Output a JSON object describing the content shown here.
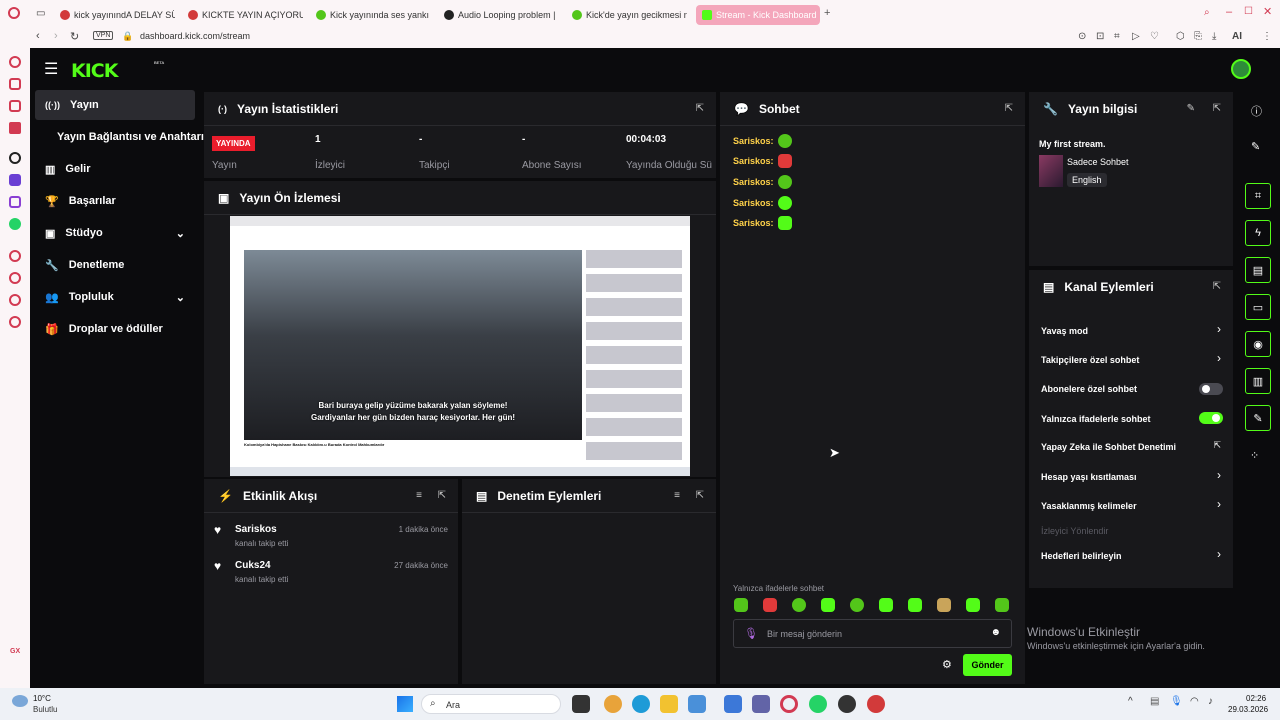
{
  "browser": {
    "tabs": [
      {
        "label": "kick yayınındA DELAY SÜR",
        "color": "#d23a3a"
      },
      {
        "label": "KICKTE YAYIN AÇIYORUM",
        "color": "#d23a3a"
      },
      {
        "label": "Kick yayınında ses yankı y",
        "color": "#53c61a"
      },
      {
        "label": "Audio Looping problem | ",
        "color": "#222222"
      },
      {
        "label": "Kick'de yayın gecikmesi n",
        "color": "#53c61a"
      },
      {
        "label": "Stream - Kick Dashboard",
        "color": "#53fc18"
      }
    ],
    "url": "dashboard.kick.com/stream",
    "vpn": "VPN",
    "ai": "AI"
  },
  "header": {
    "logo": "KICK",
    "beta": "BETA"
  },
  "nav": [
    {
      "label": "Yayın",
      "icon": "broadcast-icon"
    },
    {
      "label": "Yayın Bağlantısı ve Anahtarı",
      "icon": ""
    },
    {
      "label": "Gelir",
      "icon": "chart-icon"
    },
    {
      "label": "Başarılar",
      "icon": "trophy-icon"
    },
    {
      "label": "Stüdyo",
      "icon": "studio-icon"
    },
    {
      "label": "Denetleme",
      "icon": "wrench-icon"
    },
    {
      "label": "Topluluk",
      "icon": "people-icon"
    },
    {
      "label": "Droplar ve ödüller",
      "icon": "gift-icon"
    }
  ],
  "stats": {
    "title": "Yayın İstatistikleri",
    "live": "YAYINDA",
    "items": [
      {
        "value": "",
        "label": "Yayın"
      },
      {
        "value": "1",
        "label": "İzleyici"
      },
      {
        "value": "-",
        "label": "Takipçi"
      },
      {
        "value": "-",
        "label": "Abone Sayısı"
      },
      {
        "value": "00:04:03",
        "label": "Yayında Olduğu Süre"
      }
    ]
  },
  "preview": {
    "title": "Yayın Ön İzlemesi",
    "subtitle_line1": "Bari buraya gelip yüzüme bakarak yalan söyleme!",
    "subtitle_line2": "Gardiyanlar her gün bizden haraç kesiyorlar. Her gün!",
    "video_title": "Kolombiya'da Hapishane Baskısı Kalıldını.u Burada Kontrol Mahkumlardır"
  },
  "activity": {
    "title": "Etkinlik Akışı",
    "items": [
      {
        "user": "Sariskos",
        "action": "kanalı takip etti",
        "time": "1 dakika önce"
      },
      {
        "user": "Cuks24",
        "action": "kanalı takip etti",
        "time": "27 dakika önce"
      }
    ]
  },
  "moderation": {
    "title": "Denetim Eylemleri"
  },
  "chat": {
    "title": "Sohbet",
    "messages": [
      {
        "user": "Sariskos:",
        "emote": "#53c61a"
      },
      {
        "user": "Sariskos:",
        "emote": "#e03a3a"
      },
      {
        "user": "Sariskos:",
        "emote": "#53c61a"
      },
      {
        "user": "Sariskos:",
        "emote": "#53fc18"
      },
      {
        "user": "Sariskos:",
        "emote": "#53fc18"
      }
    ],
    "emotes_only": "Yalnızca ifadelerle sohbet",
    "placeholder": "Bir mesaj gönderin",
    "send": "Gönder"
  },
  "info": {
    "title": "Yayın bilgisi",
    "stream_title": "My first stream.",
    "category": "Sadece Sohbet",
    "language": "English"
  },
  "channel": {
    "title": "Kanal Eylemleri",
    "items": [
      {
        "label": "Yavaş mod",
        "type": "chevron"
      },
      {
        "label": "Takipçilere özel sohbet",
        "type": "chevron"
      },
      {
        "label": "Abonelere özel sohbet",
        "type": "toggle-off"
      },
      {
        "label": "Yalnızca ifadelerle sohbet",
        "type": "toggle-on"
      },
      {
        "label": "Yapay Zeka ile Sohbet Denetimi",
        "type": "external"
      },
      {
        "label": "Hesap yaşı kısıtlaması",
        "type": "chevron"
      },
      {
        "label": "Yasaklanmış kelimeler",
        "type": "chevron"
      },
      {
        "label": "İzleyici Yönlendir",
        "type": "disabled"
      },
      {
        "label": "Hedefleri belirleyin",
        "type": "chevron"
      }
    ]
  },
  "watermark": {
    "line1": "Windows'u Etkinleştir",
    "line2": "Windows'u etkinleştirmek için Ayarlar'a gidin."
  },
  "taskbar": {
    "temp": "10°C",
    "weather": "Bulutlu",
    "search": "Ara",
    "time": "02:26",
    "date": "29.03.2026"
  }
}
